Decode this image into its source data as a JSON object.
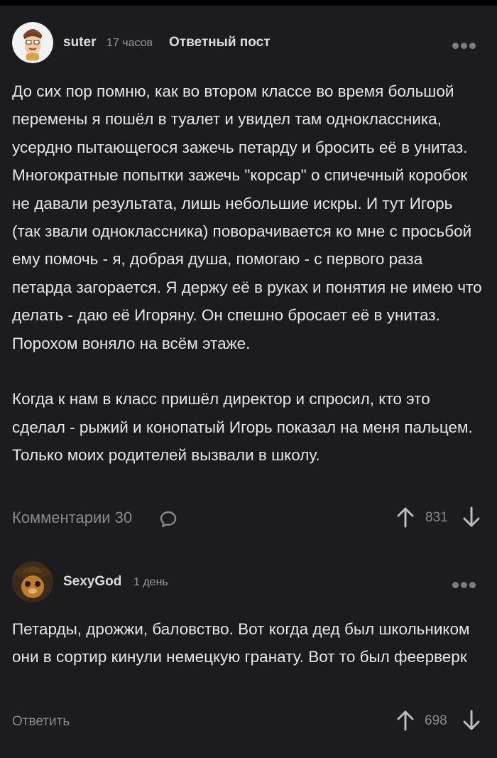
{
  "post": {
    "author": "suter",
    "time": "17 часов",
    "tag": "Ответный пост",
    "body": "До сих пор помню, как во втором классе во время большой перемены я пошёл в туалет и увидел там одноклассника, усердно пытающегося зажечь петарду и бросить её в унитаз. Многократные попытки зажечь \"корсар\" о спичечный коробок не давали результата, лишь небольшие искры. И тут Игорь (так звали одноклассника) поворачивается ко мне с просьбой ему помочь - я, добрая душа, помогаю - с первого раза петарда загорается. Я держу её в руках и понятия не имею что делать - даю её Игоряну. Он спешно бросает её в унитаз. Порохом воняло на всём этаже.\n\nКогда к нам в класс пришёл директор и спросил, кто это сделал - рыжий и конопатый Игорь показал на меня пальцем. Только моих родителей вызвали в школу.",
    "comments_label": "Комментарии 30",
    "rating": "831",
    "icons": {
      "avatar": "avatar-cartoon-icon",
      "menu": "more-dots-icon",
      "comment": "comment-bubble-icon",
      "up": "arrow-up-icon",
      "down": "arrow-down-icon"
    }
  },
  "comment": {
    "author": "SexyGod",
    "time": "1 день",
    "body": "Петарды, дрожжи, баловство. Вот когда дед был школьником они в сортир кинули немецкую гранату. Вот то был феерверк",
    "reply_label": "Ответить",
    "rating": "698"
  },
  "colors": {
    "background": "#1c1c1e",
    "text": "#e6e6e6",
    "muted": "#8a8a8a"
  }
}
